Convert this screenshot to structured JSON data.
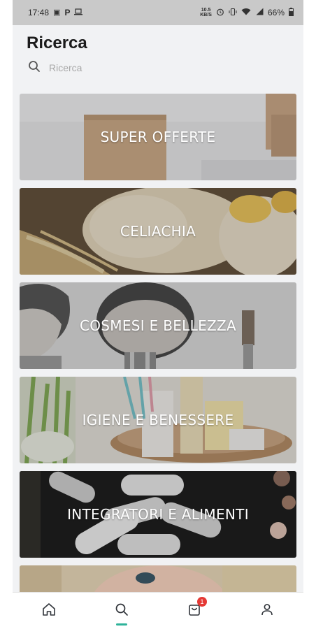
{
  "status_bar": {
    "time": "17:48",
    "p_glyph": "P",
    "data_speed_top": "10.5",
    "data_speed_bottom": "KB/S",
    "battery": "66%",
    "icons": [
      "image-icon",
      "parking-icon",
      "laptop-icon",
      "alarm-icon",
      "vibrate-icon",
      "wifi-icon",
      "signal-icon",
      "battery-icon"
    ]
  },
  "header": {
    "title": "Ricerca"
  },
  "search": {
    "placeholder": "Ricerca",
    "icon": "search-icon"
  },
  "categories": [
    {
      "label": "SUPER OFFERTE"
    },
    {
      "label": "CELIACHIA"
    },
    {
      "label": "COSMESI E BELLEZZA"
    },
    {
      "label": "IGIENE E BENESSERE"
    },
    {
      "label": "INTEGRATORI E ALIMENTI"
    },
    {
      "label": ""
    }
  ],
  "nav": {
    "items": [
      {
        "name": "home",
        "icon": "home-icon"
      },
      {
        "name": "search",
        "icon": "search-icon",
        "active": true
      },
      {
        "name": "cart",
        "icon": "cart-icon",
        "badge": "1"
      },
      {
        "name": "profile",
        "icon": "user-icon"
      }
    ]
  },
  "colors": {
    "accent": "#2fb39a",
    "badge": "#e53935",
    "background": "#f1f2f4"
  }
}
